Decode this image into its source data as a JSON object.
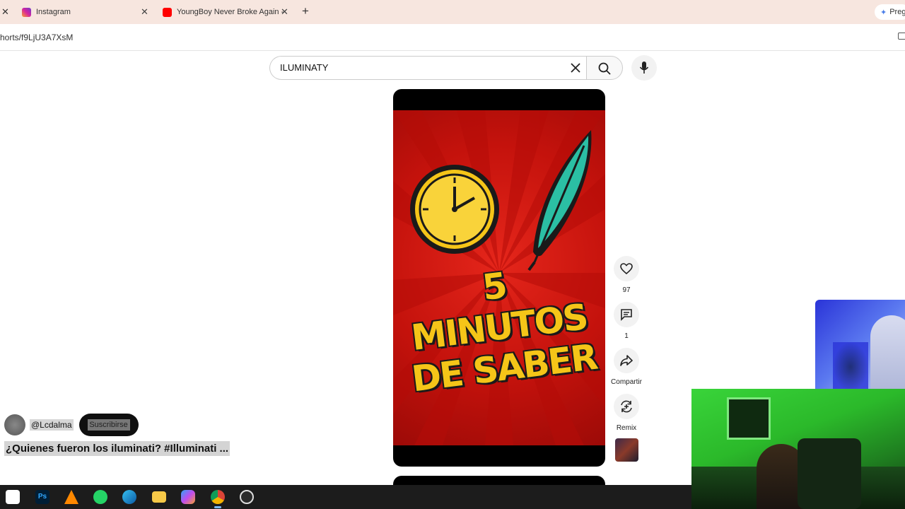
{
  "browser": {
    "tabs": [
      {
        "title": "Instagram",
        "favicon_color": "#d6249f"
      },
      {
        "title": "YoungBoy Never Broke Again -",
        "favicon_color": "#ff0000"
      }
    ],
    "new_tab_symbol": "+",
    "profile_label": "Preg",
    "url": "horts/f9LjU3A7XsM"
  },
  "search": {
    "query": "ILUMINATY"
  },
  "video": {
    "title_line1": "5 MINUTOS",
    "title_line2": "DE SABER",
    "bg_color": "#d0180f",
    "accent_yellow": "#f5c518",
    "feather_color": "#2bbfa4"
  },
  "actions": {
    "like_count": "97",
    "comment_count": "1",
    "share_label": "Compartir",
    "remix_label": "Remix"
  },
  "channel": {
    "handle": "@Lcdalma",
    "subscribe_label": "Suscribirse",
    "video_title": "¿Quienes fueron los iluminati? #Illuminati ..."
  },
  "taskbar": {
    "apps": [
      "capcut-icon",
      "photoshop-icon",
      "vlc-icon",
      "whatsapp-icon",
      "edge-icon",
      "file-explorer-icon",
      "copilot-icon",
      "chrome-icon",
      "obs-icon"
    ],
    "ps_label": "Ps"
  }
}
